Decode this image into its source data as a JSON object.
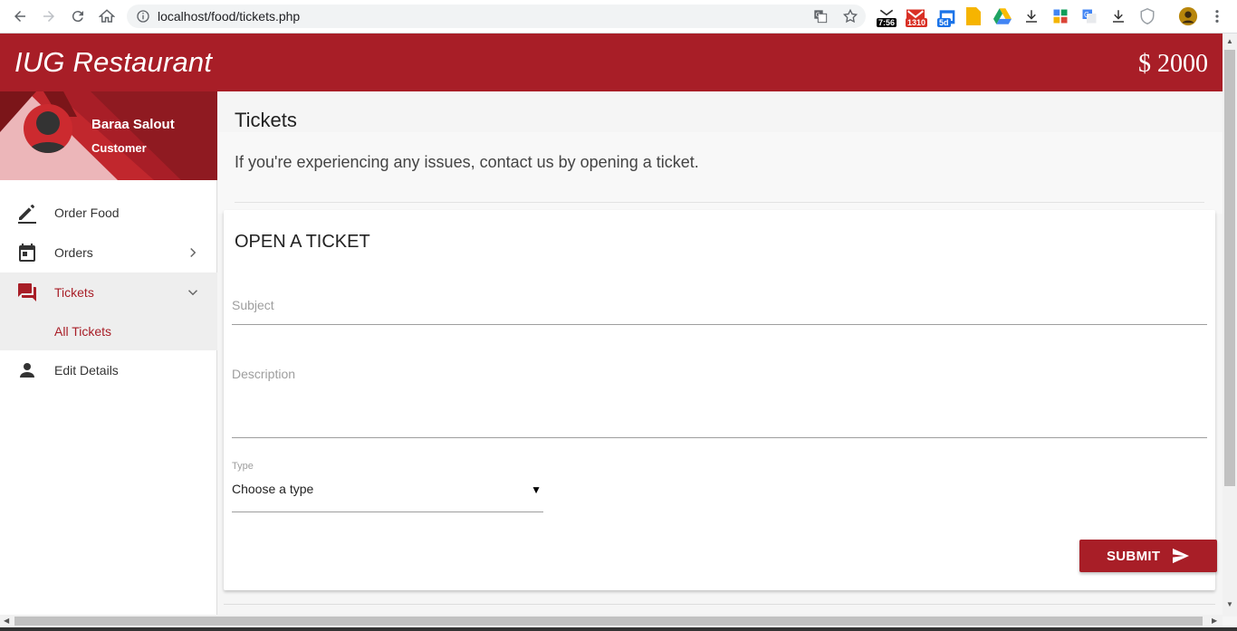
{
  "browser": {
    "url": "localhost/food/tickets.php",
    "extensions": [
      {
        "icon": "clock-extension-icon",
        "badge": "7:56",
        "badge_color": "#000000"
      },
      {
        "icon": "gmail-icon",
        "badge": "1310",
        "badge_color": "#d93025"
      },
      {
        "icon": "calendar-extension-icon",
        "badge": "5d",
        "badge_color": "#1a73e8"
      },
      {
        "icon": "keep-icon"
      },
      {
        "icon": "drive-icon"
      },
      {
        "icon": "download-icon"
      },
      {
        "icon": "grid-extension-icon"
      },
      {
        "icon": "google-translate-icon"
      },
      {
        "icon": "download-icon"
      },
      {
        "icon": "shield-icon"
      },
      {
        "icon": "profile-avatar-icon"
      },
      {
        "icon": "kebab-menu-icon"
      }
    ]
  },
  "app": {
    "brand": "IUG Restaurant",
    "balance": "$ 2000",
    "accent_color": "#a81e27"
  },
  "user": {
    "name": "Baraa Salout",
    "role": "Customer"
  },
  "sidebar": {
    "items": [
      {
        "label": "Order Food",
        "icon": "pencil-icon"
      },
      {
        "label": "Orders",
        "icon": "calendar-icon"
      },
      {
        "label": "Tickets",
        "icon": "forum-icon"
      },
      {
        "label": "All Tickets"
      },
      {
        "label": "Edit Details",
        "icon": "person-icon"
      }
    ]
  },
  "page": {
    "title": "Tickets",
    "intro": "If you're experiencing any issues, contact us by opening a ticket."
  },
  "form": {
    "title": "OPEN A TICKET",
    "subject_label": "Subject",
    "description_label": "Description",
    "type_label": "Type",
    "type_value": "Choose a type",
    "submit_label": "SUBMIT"
  }
}
